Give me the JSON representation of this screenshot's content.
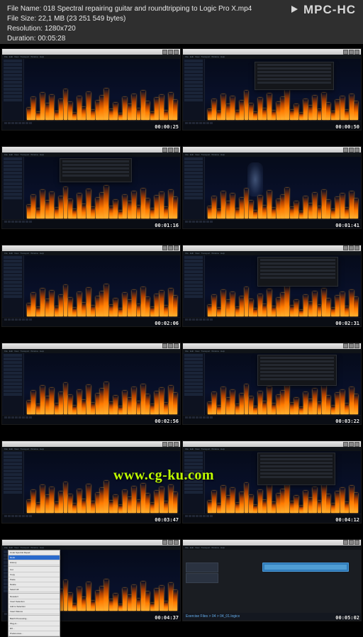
{
  "player_brand": "MPC-HC",
  "meta": {
    "name_label": "File Name:",
    "name_value": "018 Spectral repairing guitar and roundtripping to Logic Pro X.mp4",
    "size_label": "File Size:",
    "size_value": "22,1 MB (23 251 549 bytes)",
    "res_label": "Resolution:",
    "res_value": "1280x720",
    "dur_label": "Duration:",
    "dur_value": "00:05:28"
  },
  "watermark": "www.cg-ku.com",
  "tiles": {
    "tc": [
      "00:00:25",
      "00:00:50",
      "00:01:16",
      "00:01:41",
      "00:02:06",
      "00:02:31",
      "00:02:56",
      "00:03:22",
      "00:03:47",
      "00:04:12",
      "00:04:37",
      "00:05:02"
    ]
  },
  "daw": {
    "footer_path": "Exercise Files > 04 > 04_01.logicx"
  },
  "dropdown_items": [
    "Undo Spectral Repair",
    "Redo",
    "History",
    "Cut",
    "Copy",
    "Paste",
    "Delete",
    "Select All",
    "Deselect",
    "Invert Selection",
    "Add to Selection",
    "Insert Silence",
    "Batch Processing...",
    "Plug-in...",
    "RX...",
    "Preferences..."
  ],
  "bar_sets": [
    [
      32,
      58,
      20,
      70,
      42,
      64,
      22,
      54,
      78,
      46,
      18,
      60,
      34,
      72,
      26,
      50,
      62,
      80,
      28,
      44,
      16,
      58,
      40,
      66,
      30,
      74,
      48,
      20,
      56,
      64,
      24,
      70,
      52
    ],
    [
      28,
      54,
      22,
      66,
      40,
      60,
      24,
      50,
      74,
      42,
      20,
      56,
      30,
      68,
      24,
      46,
      58,
      76,
      26,
      40,
      18,
      54,
      36,
      62,
      28,
      70,
      44,
      22,
      52,
      60,
      26,
      66,
      48
    ],
    [
      34,
      60,
      24,
      72,
      44,
      66,
      26,
      56,
      80,
      48,
      22,
      62,
      36,
      74,
      28,
      52,
      64,
      82,
      30,
      46,
      20,
      60,
      42,
      68,
      32,
      76,
      50,
      24,
      58,
      66,
      28,
      72,
      54
    ],
    [
      30,
      56,
      22,
      68,
      42,
      62,
      24,
      52,
      76,
      44,
      20,
      58,
      32,
      70,
      26,
      48,
      60,
      78,
      28,
      42,
      18,
      56,
      38,
      64,
      30,
      72,
      46,
      22,
      54,
      62,
      26,
      68,
      50
    ],
    [
      33,
      59,
      23,
      71,
      43,
      65,
      25,
      55,
      79,
      47,
      21,
      61,
      35,
      73,
      27,
      51,
      63,
      81,
      29,
      45,
      19,
      59,
      41,
      67,
      31,
      75,
      49,
      23,
      57,
      65,
      27,
      71,
      53
    ],
    [
      29,
      55,
      21,
      67,
      41,
      61,
      23,
      51,
      75,
      43,
      19,
      57,
      31,
      69,
      25,
      47,
      59,
      77,
      27,
      41,
      17,
      55,
      37,
      63,
      29,
      71,
      45,
      21,
      53,
      61,
      25,
      67,
      49
    ],
    [
      35,
      61,
      25,
      73,
      45,
      67,
      27,
      57,
      81,
      49,
      23,
      63,
      37,
      75,
      29,
      53,
      65,
      83,
      31,
      47,
      21,
      61,
      43,
      69,
      33,
      77,
      51,
      25,
      59,
      67,
      29,
      73,
      55
    ],
    [
      31,
      57,
      23,
      69,
      43,
      63,
      25,
      53,
      77,
      45,
      21,
      59,
      33,
      71,
      27,
      49,
      61,
      79,
      29,
      43,
      19,
      57,
      39,
      65,
      31,
      73,
      47,
      23,
      55,
      63,
      27,
      69,
      51
    ],
    [
      32,
      58,
      24,
      70,
      44,
      64,
      26,
      54,
      78,
      46,
      22,
      60,
      34,
      72,
      28,
      50,
      62,
      80,
      30,
      44,
      20,
      58,
      40,
      66,
      32,
      74,
      48,
      24,
      56,
      64,
      28,
      70,
      52
    ],
    [
      30,
      56,
      22,
      68,
      42,
      62,
      24,
      52,
      76,
      44,
      20,
      58,
      32,
      70,
      26,
      48,
      60,
      78,
      28,
      42,
      18,
      56,
      38,
      64,
      30,
      72,
      46,
      22,
      54,
      62,
      26,
      68,
      50
    ]
  ]
}
